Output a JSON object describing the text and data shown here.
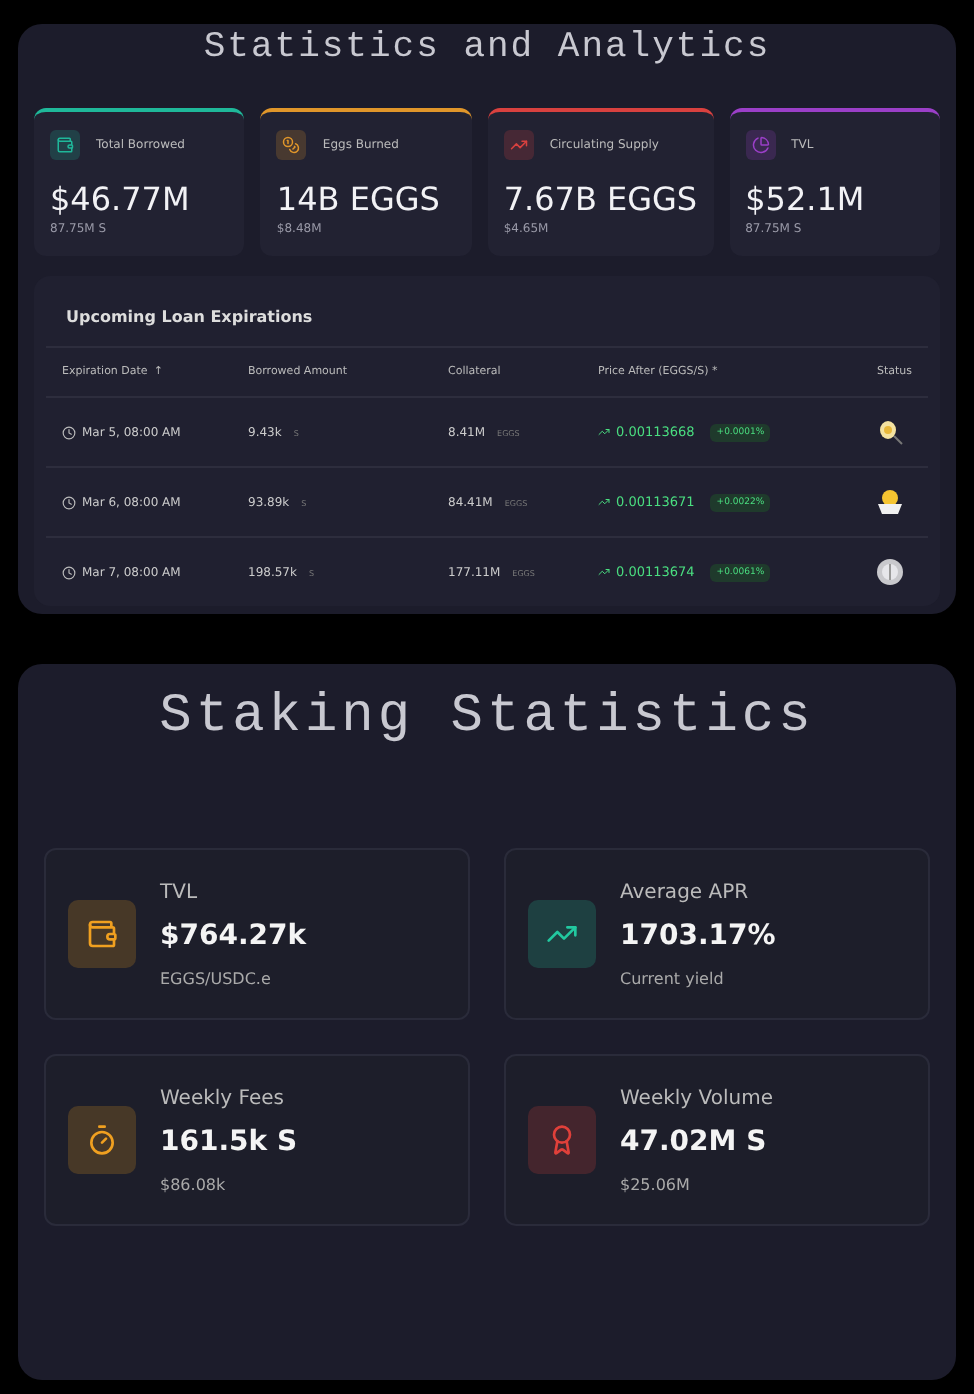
{
  "analytics": {
    "title": "Statistics and Analytics",
    "cards": [
      {
        "label": "Total Borrowed",
        "value": "$46.77M",
        "sub": "87.75M S",
        "color": "#1fb89a",
        "kind": "wallet"
      },
      {
        "label": "Eggs Burned",
        "value": "14B EGGS",
        "sub": "$8.48M",
        "color": "#e0962a",
        "kind": "coins"
      },
      {
        "label": "Circulating Supply",
        "value": "7.67B EGGS",
        "sub": "$4.65M",
        "color": "#d9413f",
        "kind": "trend"
      },
      {
        "label": "TVL",
        "value": "$52.1M",
        "sub": "87.75M S",
        "color": "#9b3fc8",
        "kind": "pie"
      }
    ],
    "loans": {
      "title": "Upcoming Loan Expirations",
      "columns": [
        "Expiration Date",
        "Borrowed Amount",
        "Collateral",
        "Price After (EGGS/S) *",
        "Status"
      ],
      "sort_mark": "↑",
      "rows": [
        {
          "date": "Mar 5, 08:00 AM",
          "borrowed": "9.43k",
          "borrowed_unit": "S",
          "collateral": "8.41M",
          "collateral_unit": "EGGS",
          "price": "0.00113668",
          "change": "+0.0001%",
          "kind": "egg"
        },
        {
          "date": "Mar 6, 08:00 AM",
          "borrowed": "93.89k",
          "borrowed_unit": "S",
          "collateral": "84.41M",
          "collateral_unit": "EGGS",
          "price": "0.00113671",
          "change": "+0.0022%",
          "kind": "chick"
        },
        {
          "date": "Mar 7, 08:00 AM",
          "borrowed": "198.57k",
          "borrowed_unit": "S",
          "collateral": "177.11M",
          "collateral_unit": "EGGS",
          "price": "0.00113674",
          "change": "+0.0061%",
          "kind": "coin"
        }
      ]
    }
  },
  "staking": {
    "title": "Staking Statistics",
    "cards": [
      {
        "label": "TVL",
        "value": "$764.27k",
        "sub": "EGGS/USDC.e",
        "color": "#f0a020",
        "kind": "wallet"
      },
      {
        "label": "Average APR",
        "value": "1703.17%",
        "sub": "Current yield",
        "color": "#22c9a0",
        "kind": "trend"
      },
      {
        "label": "Weekly Fees",
        "value": "161.5k S",
        "sub": "$86.08k",
        "color": "#f0a020",
        "kind": "timer"
      },
      {
        "label": "Weekly Volume",
        "value": "47.02M S",
        "sub": "$25.06M",
        "color": "#e0403a",
        "kind": "award"
      }
    ]
  }
}
